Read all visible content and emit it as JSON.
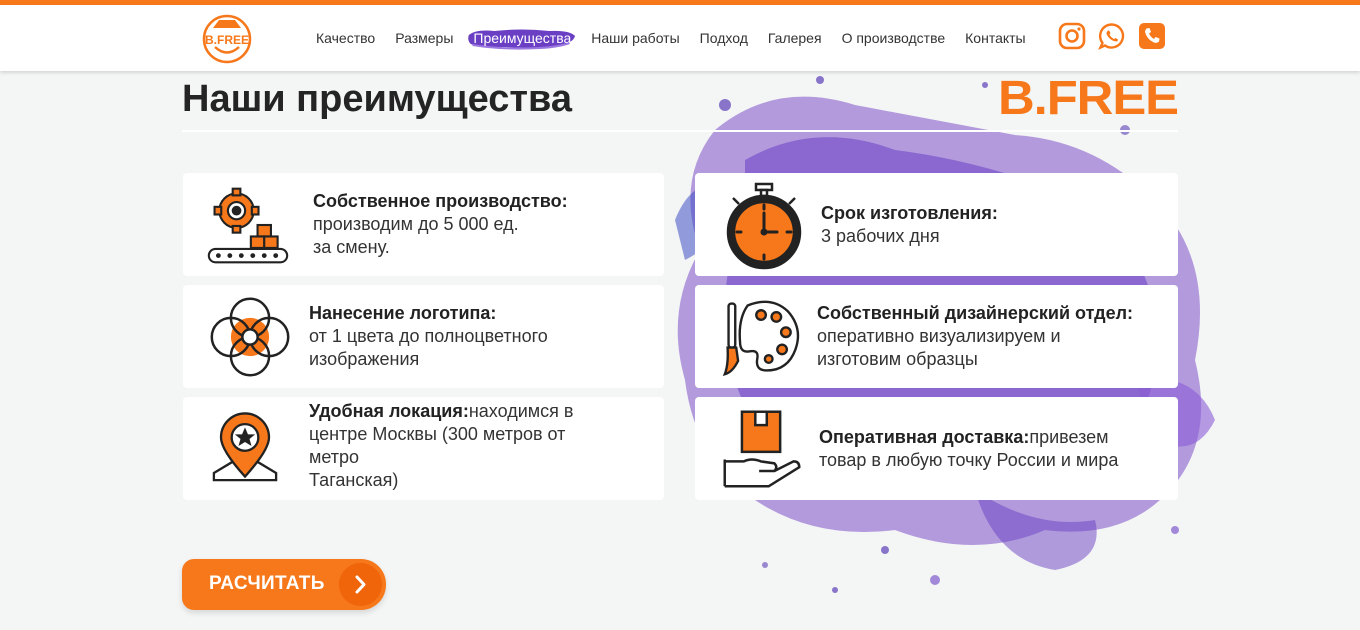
{
  "nav": {
    "items": [
      "Качество",
      "Размеры",
      "Преимущества",
      "Наши работы",
      "Подход",
      "Галерея",
      "О производстве",
      "Контакты"
    ],
    "active_index": 2
  },
  "header": {
    "logo_text": "B.FREE",
    "socials": [
      "instagram-icon",
      "whatsapp-icon",
      "phone-icon"
    ]
  },
  "section": {
    "title": "Наши преимущества",
    "brand_logo": "B.FREE"
  },
  "advantages": [
    {
      "icon": "factory-gear-icon",
      "title": "Собственное производство:",
      "lines": [
        "производим до 5 000 ед.",
        "за смену."
      ]
    },
    {
      "icon": "stopwatch-icon",
      "title": "Срок изготовления:",
      "lines": [
        "3 рабочих дня"
      ]
    },
    {
      "icon": "color-circles-icon",
      "title": "Нанесение логотипа:",
      "lines": [
        "от 1 цвета до полноцветного",
        "изображения"
      ]
    },
    {
      "icon": "palette-icon",
      "title": "Собственный дизайнерский отдел:",
      "lines": [
        "оперативно визуализируем и",
        "изготовим образцы"
      ]
    },
    {
      "icon": "map-pin-icon",
      "title": "Удобная локация:",
      "inline": "находимся в",
      "lines": [
        "центре Москвы (300 метров от",
        "метро",
        "Таганская)"
      ]
    },
    {
      "icon": "delivery-box-icon",
      "title": "Оперативная доставка:",
      "inline": "привезем",
      "lines": [
        "товар в любую точку России и мира"
      ]
    }
  ],
  "cta": {
    "label": "РАСЧИТАТЬ"
  },
  "colors": {
    "accent": "#f7781a",
    "purple": "#7b4fc9",
    "text": "#222222",
    "background": "#f4f5f5"
  }
}
